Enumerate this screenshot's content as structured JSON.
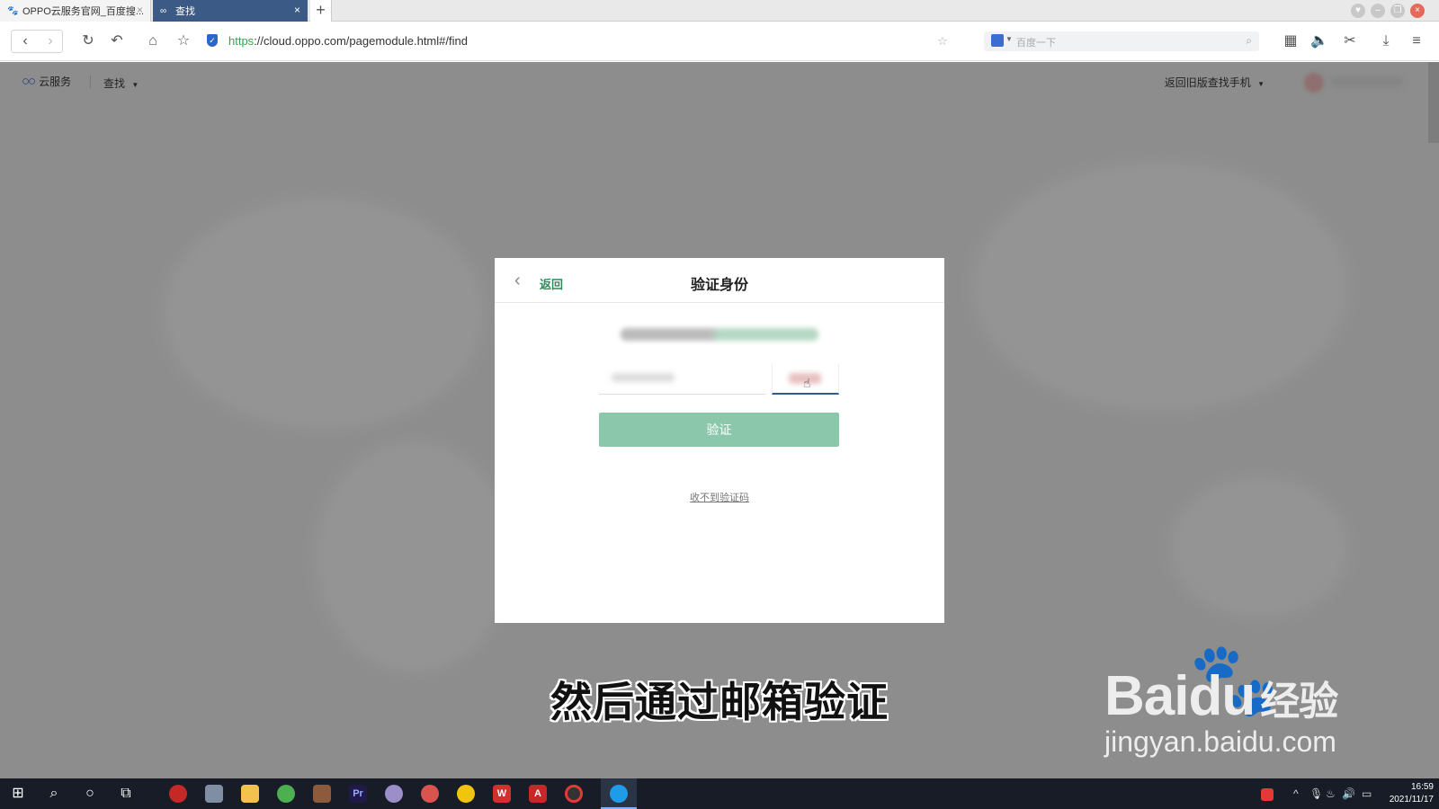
{
  "browser": {
    "tabs": [
      {
        "title": "OPPO云服务官网_百度搜..."
      },
      {
        "title": "查找"
      }
    ],
    "new_tab": "+",
    "url_scheme": "https",
    "url_rest": "://cloud.oppo.com/pagemodule.html#/find",
    "search_placeholder": "百度一下"
  },
  "page": {
    "logo_text": "云服务",
    "find_menu": "查找",
    "old_version": "返回旧版查找手机"
  },
  "modal": {
    "back_label": "返回",
    "title": "验证身份",
    "verify_button": "验证",
    "no_code_link": "收不到验证码"
  },
  "overlay": {
    "subtitle": "然后通过邮箱验证",
    "watermark_main": "Bai",
    "watermark_du": "du",
    "watermark_jy": "经验",
    "watermark_url": "jingyan.baidu.com"
  },
  "taskbar": {
    "time": "16:59",
    "date": "2021/11/17"
  },
  "colors": {
    "accent_green": "#2f8a5d",
    "verify_button_bg": "#8bc8ab",
    "overlay_gray": "#8d8d8d",
    "active_tab": "#3c5a86"
  }
}
